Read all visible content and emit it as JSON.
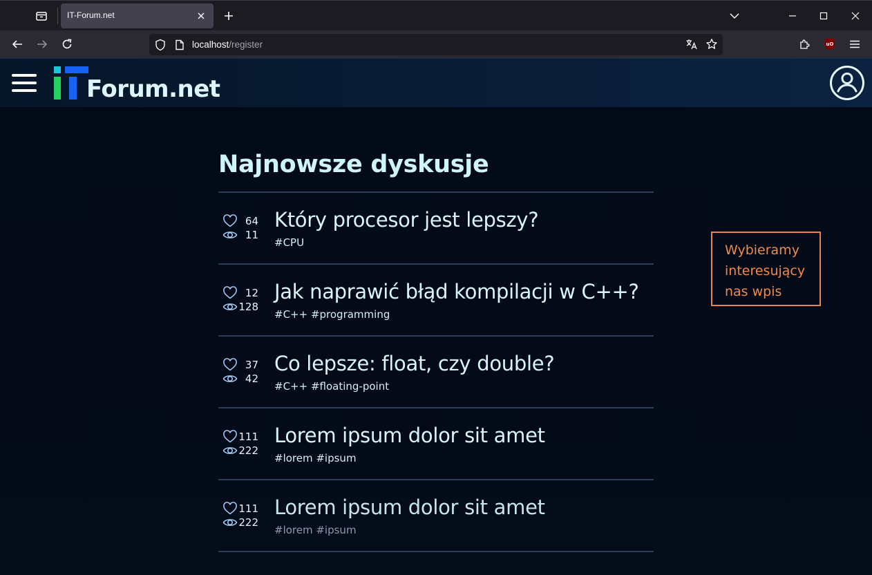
{
  "browser": {
    "tab_title": "IT-Forum.net",
    "url_host": "localhost",
    "url_path": "/register"
  },
  "site": {
    "logo_text": "Forum.net",
    "colors": {
      "brand_blue": "#1763f5",
      "brand_green": "#24d05e",
      "brand_cyan": "#1fc4d6",
      "annotation": "#f08a4c"
    }
  },
  "feed": {
    "title": "Najnowsze dyskusje",
    "posts": [
      {
        "likes": "64",
        "views": "11",
        "title": "Który procesor jest lepszy?",
        "tags": "#CPU"
      },
      {
        "likes": "12",
        "views": "128",
        "title": "Jak naprawić błąd kompilacji w C++?",
        "tags": "#C++ #programming"
      },
      {
        "likes": "37",
        "views": "42",
        "title": "Co lepsze: float, czy double?",
        "tags": "#C++ #floating-point"
      },
      {
        "likes": "111",
        "views": "222",
        "title": "Lorem ipsum dolor sit amet",
        "tags": "#lorem #ipsum"
      },
      {
        "likes": "111",
        "views": "222",
        "title": "Lorem ipsum dolor sit amet",
        "tags": "#lorem #ipsum"
      }
    ]
  },
  "annotation": {
    "lines": [
      "Wybieramy",
      "interesujący",
      "nas wpis"
    ]
  }
}
